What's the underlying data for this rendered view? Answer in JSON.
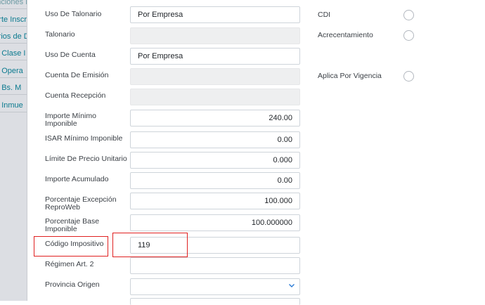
{
  "sidebar": {
    "items": [
      {
        "label": "Retenciones Li..."
      },
      {
        "label": "Reporte Inscri"
      },
      {
        "label": "Usuarios de D"
      },
      {
        "label": "Retenciones Clase I"
      },
      {
        "label": "Retenciones Opera"
      },
      {
        "label": "Retenciones Bs. M"
      },
      {
        "label": "Retenciones Inmue"
      }
    ]
  },
  "form": {
    "uso_talonario": {
      "label": "Uso De Talonario",
      "value": "Por Empresa"
    },
    "talonario": {
      "label": "Talonario",
      "value": ""
    },
    "uso_cuenta": {
      "label": "Uso De Cuenta",
      "value": "Por Empresa"
    },
    "cuenta_emision": {
      "label": "Cuenta De Emisión",
      "value": ""
    },
    "cuenta_recepcion": {
      "label": "Cuenta Recepción",
      "value": ""
    },
    "importe_minimo": {
      "label_line1": "Importe Mínimo",
      "label_line2": "Imponible",
      "value": "240.00"
    },
    "isar_minimo": {
      "label": "ISAR Mínimo Imponible",
      "value": "0.00"
    },
    "limite_precio": {
      "label": "Límite De Precio Unitario",
      "value": "0.000"
    },
    "importe_acumulado": {
      "label": "Importe Acumulado",
      "value": "0.00"
    },
    "porcentaje_excepcion": {
      "label_line1": "Porcentaje Excepción",
      "label_line2": "ReproWeb",
      "value": "100.000"
    },
    "porcentaje_base": {
      "label_line1": "Porcentaje Base",
      "label_line2": "Imponible",
      "value": "100.000000"
    },
    "codigo_impositivo": {
      "label": "Código Impositivo",
      "value": "119"
    },
    "regimen": {
      "label": "Régimen Art. 2",
      "value": ""
    },
    "provincia_origen": {
      "label": "Provincia Origen",
      "value": ""
    }
  },
  "options": {
    "cdi": {
      "label": "CDI"
    },
    "acrecentamiento": {
      "label": "Acrecentamiento"
    },
    "aplica_vigencia": {
      "label": "Aplica Por Vigencia"
    }
  },
  "highlight_color": "#e02020",
  "accent_color": "#0b7a8f"
}
